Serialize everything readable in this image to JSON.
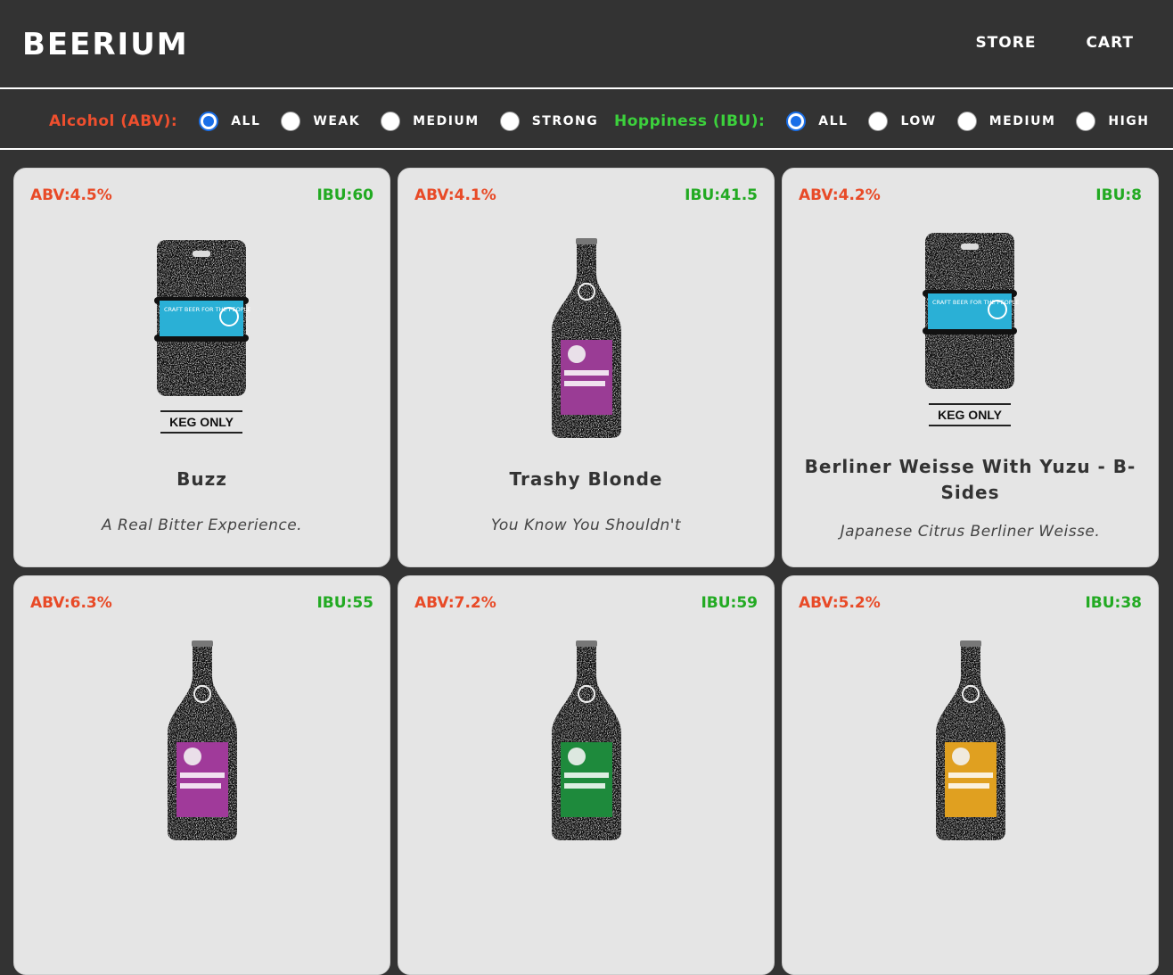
{
  "header": {
    "logo": "BEERIUM",
    "nav": [
      "STORE",
      "CART"
    ]
  },
  "filters": {
    "abv": {
      "label": "Alcohol (ABV):",
      "color": "#ef4f2e",
      "options": [
        "ALL",
        "WEAK",
        "MEDIUM",
        "STRONG"
      ],
      "selected": "ALL"
    },
    "ibu": {
      "label": "Hoppiness (IBU):",
      "color": "#3cd13c",
      "options": [
        "ALL",
        "LOW",
        "MEDIUM",
        "HIGH"
      ],
      "selected": "ALL"
    }
  },
  "colors": {
    "abv": "#e84a27",
    "ibu": "#22aa22",
    "card": "#e5e5e5",
    "background": "#333333"
  },
  "beers": [
    {
      "abv": "ABV:4.5%",
      "ibu": "IBU:60",
      "name": "Buzz",
      "tagline": "A Real Bitter Experience.",
      "image": "keg-icon",
      "label_color": "#2ab0d6",
      "keg_text": "KEG ONLY",
      "keg_label": "CRAFT BEER FOR THE PEOPLE"
    },
    {
      "abv": "ABV:4.1%",
      "ibu": "IBU:41.5",
      "name": "Trashy Blonde",
      "tagline": "You Know You Shouldn't",
      "image": "bottle-icon",
      "label_color": "#9a3c95"
    },
    {
      "abv": "ABV:4.2%",
      "ibu": "IBU:8",
      "name": "Berliner Weisse With Yuzu - B-Sides",
      "tagline": "Japanese Citrus Berliner Weisse.",
      "image": "keg-icon",
      "label_color": "#2ab0d6",
      "keg_text": "KEG ONLY",
      "keg_label": "CRAFT BEER FOR THE PEOPLE"
    },
    {
      "abv": "ABV:6.3%",
      "ibu": "IBU:55",
      "name": "",
      "tagline": "",
      "image": "bottle-icon",
      "label_color": "#a03a9a"
    },
    {
      "abv": "ABV:7.2%",
      "ibu": "IBU:59",
      "name": "",
      "tagline": "",
      "image": "bottle-icon",
      "label_color": "#1e8a3c"
    },
    {
      "abv": "ABV:5.2%",
      "ibu": "IBU:38",
      "name": "",
      "tagline": "",
      "image": "bottle-icon",
      "label_color": "#e0a020"
    }
  ]
}
